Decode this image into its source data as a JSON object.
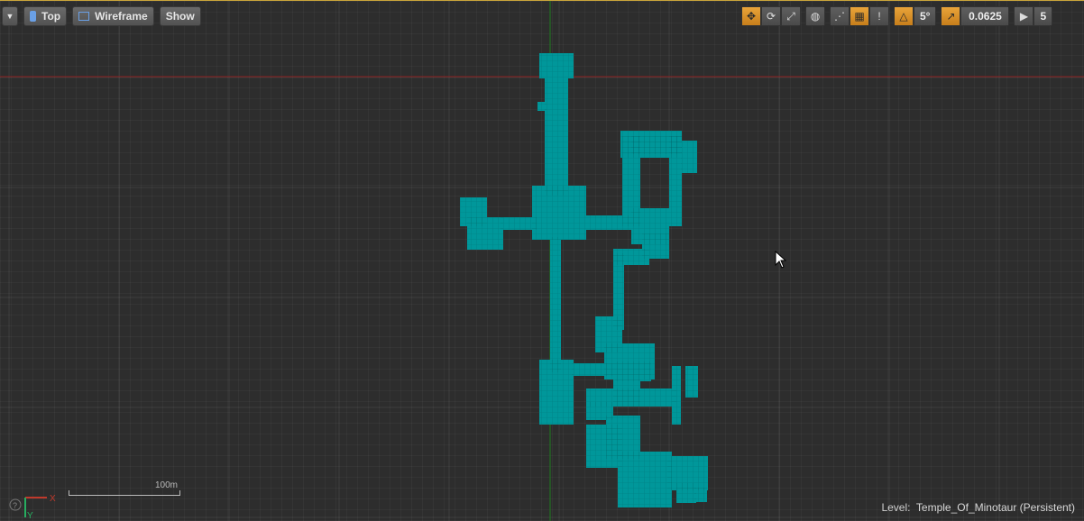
{
  "toolbar_left": {
    "menu_icon": "chevron-down-icon",
    "view_label": "Top",
    "view_icon": "camera-icon",
    "mode_label": "Wireframe",
    "mode_icon": "wireframe-icon",
    "show_label": "Show"
  },
  "toolbar_right": {
    "rotation_snap": "5°",
    "scale_snap": "0.0625",
    "camera_speed": "5"
  },
  "scale_bar": {
    "label": "100m"
  },
  "axis": {
    "x_label": "X",
    "y_label": "Y"
  },
  "status": {
    "level_prefix": "Level:",
    "level_name": "Temple_Of_Minotaur (Persistent)"
  },
  "colors": {
    "navmesh": "#00979a",
    "accent": "#e19a2e",
    "axis_x": "#8a1d1d",
    "axis_y": "#1e7a1e"
  }
}
